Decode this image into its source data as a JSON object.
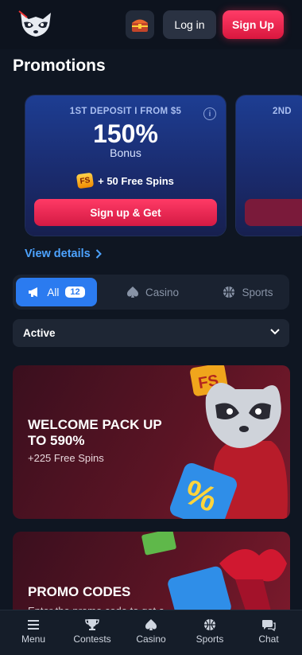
{
  "header": {
    "login_label": "Log in",
    "signup_label": "Sign Up",
    "gift_icon": "treasure-chest-icon"
  },
  "page": {
    "title": "Promotions"
  },
  "bonus_cards": [
    {
      "eyebrow": "1ST DEPOSIT I FROM $5",
      "value": "150%",
      "label": "Bonus",
      "spins_badge": "FS",
      "spins": "+ 50 Free Spins",
      "cta": "Sign up & Get"
    },
    {
      "eyebrow": "2ND"
    }
  ],
  "view_details": "View details",
  "filters": [
    {
      "label": "All",
      "count": "12",
      "icon": "megaphone-icon",
      "active": true
    },
    {
      "label": "Casino",
      "icon": "spade-icon"
    },
    {
      "label": "Sports",
      "icon": "basketball-icon"
    }
  ],
  "status_select": {
    "value": "Active"
  },
  "promos": [
    {
      "title": "WELCOME PACK UP TO 590%",
      "subtitle": "+225 Free Spins"
    },
    {
      "title": "PROMO CODES",
      "subtitle": "Enter the promo code to get a"
    }
  ],
  "bottom_nav": [
    {
      "label": "Menu",
      "icon": "menu-icon"
    },
    {
      "label": "Contests",
      "icon": "trophy-icon"
    },
    {
      "label": "Casino",
      "icon": "spade-icon"
    },
    {
      "label": "Sports",
      "icon": "basketball-icon"
    },
    {
      "label": "Chat",
      "icon": "chat-icon"
    }
  ],
  "colors": {
    "accent": "#ff2f5a",
    "primary_blue": "#2b7bf0",
    "link": "#4da3ff",
    "background": "#0f1622"
  }
}
